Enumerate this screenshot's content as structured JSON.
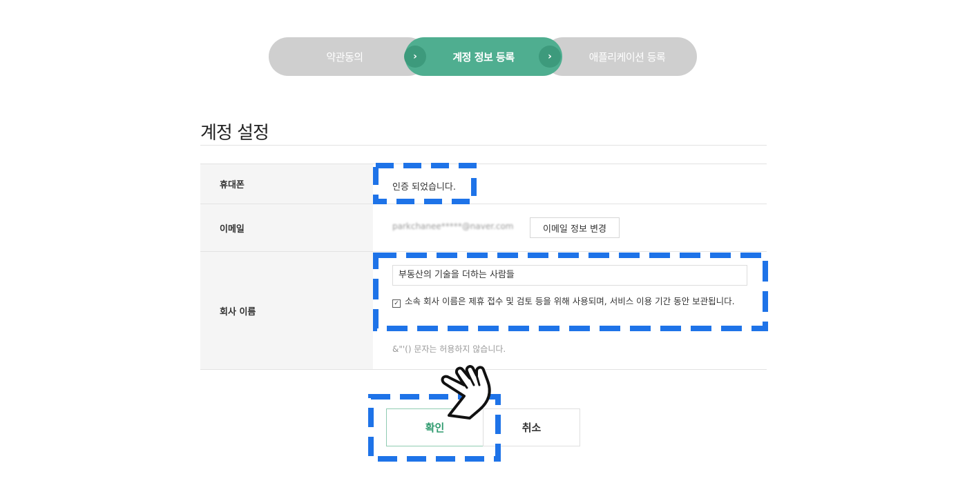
{
  "stepper": {
    "steps": [
      {
        "label": "약관동의",
        "state": "done"
      },
      {
        "label": "계정 정보 등록",
        "state": "active"
      },
      {
        "label": "애플리케이션 등록",
        "state": "pending"
      }
    ],
    "arrow_glyph": "›"
  },
  "page_title": "계정 설정",
  "form": {
    "phone": {
      "label": "휴대폰",
      "value": "인증 되었습니다."
    },
    "email": {
      "label": "이메일",
      "value": "parkchanee*****@naver.com",
      "change_button": "이메일 정보 변경"
    },
    "company": {
      "label": "회사 이름",
      "input_value": "부동산의 기술을 더하는 사람들",
      "consent_checked": true,
      "consent_text": "소속 회사 이름은 제휴 접수 및 검토 등을 위해 사용되며, 서비스 이용 기간 동안 보관됩니다.",
      "hint": "&\"'() 문자는 허용하지 않습니다."
    }
  },
  "buttons": {
    "confirm": "확인",
    "cancel": "취소"
  },
  "colors": {
    "accent": "#4fae90",
    "accent_dark": "#3d9a7c",
    "inactive_step": "#cfcfcf",
    "highlight": "#1e73e8",
    "confirm_text": "#2e9a6e"
  },
  "icons": {
    "pointer": "hand-pointer-icon",
    "check": "checkbox-check-icon"
  }
}
